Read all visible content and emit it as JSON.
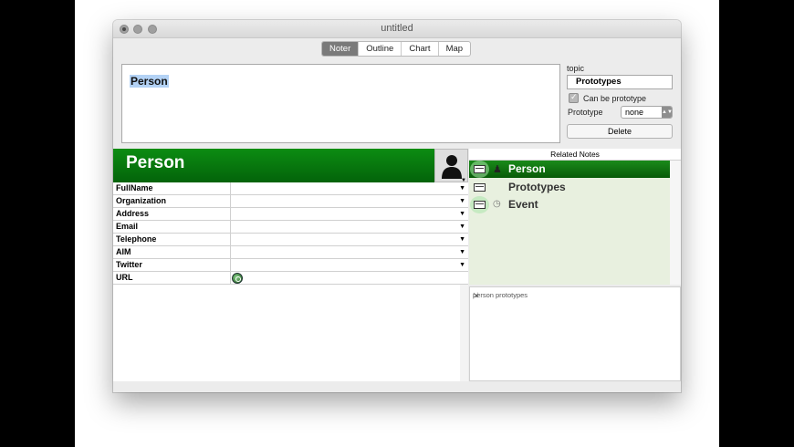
{
  "window": {
    "title": "untitled"
  },
  "tabs": [
    {
      "label": "Noter",
      "active": true
    },
    {
      "label": "Outline",
      "active": false
    },
    {
      "label": "Chart",
      "active": false
    },
    {
      "label": "Map",
      "active": false
    }
  ],
  "note_text": {
    "selected_text": "Person"
  },
  "inspector": {
    "topic_label": "topic",
    "topic_value": "Prototypes",
    "can_be_prototype_label": "Can be prototype",
    "can_be_prototype_checked": true,
    "prototype_label": "Prototype",
    "prototype_value": "none",
    "delete_label": "Delete"
  },
  "prototype_header": {
    "name": "Person",
    "avatar_icon": "person-silhouette-icon"
  },
  "attributes": [
    {
      "key": "FullName",
      "value": "",
      "has_dropdown": true
    },
    {
      "key": "Organization",
      "value": "",
      "has_dropdown": true
    },
    {
      "key": "Address",
      "value": "",
      "has_dropdown": true
    },
    {
      "key": "Email",
      "value": "",
      "has_dropdown": true
    },
    {
      "key": "Telephone",
      "value": "",
      "has_dropdown": true
    },
    {
      "key": "AIM",
      "value": "",
      "has_dropdown": true
    },
    {
      "key": "Twitter",
      "value": "",
      "has_dropdown": true
    },
    {
      "key": "URL",
      "value": "",
      "has_dropdown": false,
      "icon": "globe-icon"
    }
  ],
  "related_notes": {
    "title": "Related Notes",
    "items": [
      {
        "label": "Person",
        "selected": true,
        "icon": "person-icon"
      },
      {
        "label": "Prototypes",
        "selected": false,
        "icon": ""
      },
      {
        "label": "Event",
        "selected": false,
        "icon": "clock-icon"
      }
    ]
  },
  "tags_text": "person  prototypes",
  "colors": {
    "selection_green": "#087a0e",
    "related_bg": "#e8f0df",
    "text_highlight": "#b3d2f5"
  }
}
